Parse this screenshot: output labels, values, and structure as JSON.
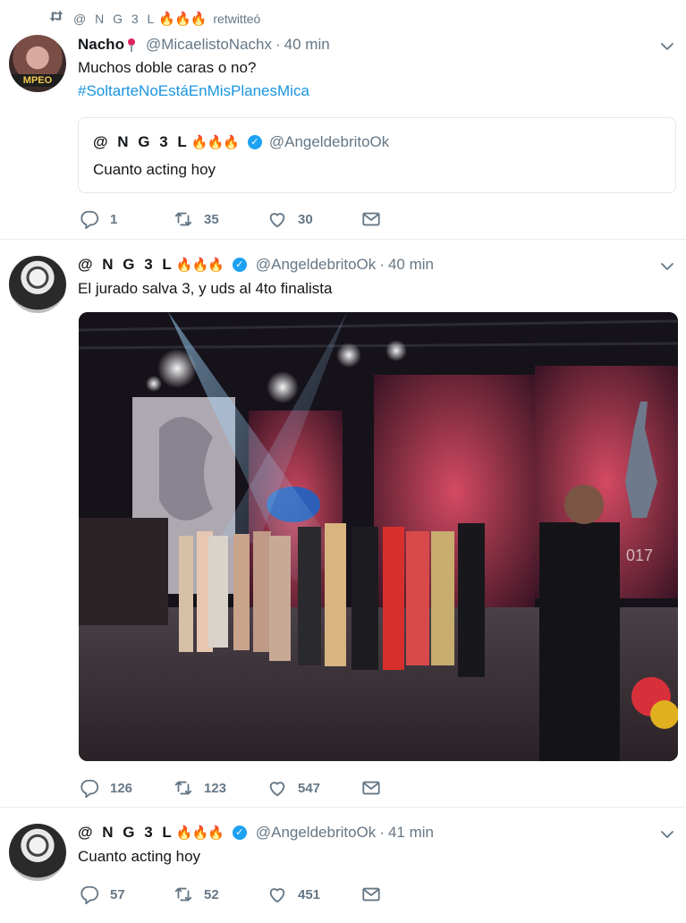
{
  "tweets": [
    {
      "retweet_context": {
        "name": "@ N G 3 L",
        "fire": "🔥🔥🔥",
        "label": "retwitteó"
      },
      "name": "Nacho",
      "handle": "@MicaelistoNachx",
      "time": "40 min",
      "text": "Muchos doble caras o no?",
      "hashtag": "#SoltarteNoEstáEnMisPlanesMica",
      "avatar_banner": "MPEO",
      "quote": {
        "name": "@ N G 3 L",
        "fire": "🔥🔥🔥",
        "handle": "@AngeldebritoOk",
        "text": "Cuanto acting hoy"
      },
      "actions": {
        "replies": "1",
        "retweets": "35",
        "likes": "30"
      }
    },
    {
      "name": "@ N G 3 L",
      "fire": "🔥🔥🔥",
      "handle": "@AngeldebritoOk",
      "time": "40 min",
      "text": "El jurado salva 3, y uds al 4to finalista",
      "media_year": "017",
      "actions": {
        "replies": "126",
        "retweets": "123",
        "likes": "547"
      }
    },
    {
      "name": "@ N G 3 L",
      "fire": "🔥🔥🔥",
      "handle": "@AngeldebritoOk",
      "time": "41 min",
      "text": "Cuanto acting hoy",
      "actions": {
        "replies": "57",
        "retweets": "52",
        "likes": "451"
      }
    }
  ],
  "separator": "·",
  "verified_glyph": "✓",
  "colors": {
    "link": "#1b95e0",
    "muted": "#657786",
    "verified": "#1da1f2",
    "fire": "#f58b0f"
  },
  "icons": [
    "retweet-icon",
    "verified-icon",
    "chevron-down-icon",
    "reply-icon",
    "like-icon",
    "direct-message-icon",
    "location-pin-icon"
  ]
}
